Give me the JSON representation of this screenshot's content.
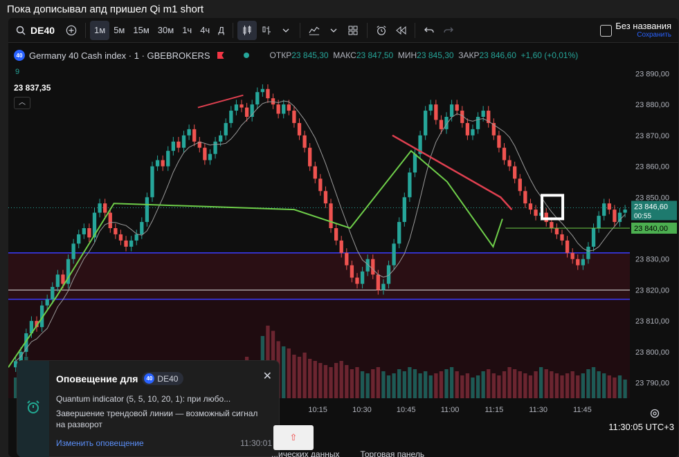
{
  "caption": "Пока дописывал апд пришел Qi m1 short",
  "toolbar": {
    "symbol": "DE40",
    "intervals": [
      {
        "label": "1м",
        "active": true
      },
      {
        "label": "5м",
        "active": false
      },
      {
        "label": "15м",
        "active": false
      },
      {
        "label": "30м",
        "active": false
      },
      {
        "label": "1ч",
        "active": false
      },
      {
        "label": "4ч",
        "active": false
      },
      {
        "label": "Д",
        "active": false
      }
    ],
    "save_title": "Без названия",
    "save_sub": "Сохранить"
  },
  "legend": {
    "badge": "40",
    "title": "Germany 40 Cash index · 1 · GBEBROKERS",
    "open_label": "ОТКР",
    "open": "23 845,30",
    "high_label": "МАКС",
    "high": "23 847,50",
    "low_label": "МИН",
    "low": "23 845,30",
    "close_label": "ЗАКР",
    "close": "23 846,60",
    "change": "+1,60 (+0,01%)",
    "sub": "9",
    "last_value": "23 837,35"
  },
  "chart_data": {
    "type": "candlestick",
    "y_ticks": [
      "23 890,00",
      "23 880,00",
      "23 870,00",
      "23 860,00",
      "23 850,00",
      "23 840,00",
      "23 830,00",
      "23 820,00",
      "23 810,00",
      "23 800,00",
      "23 790,00"
    ],
    "ylim": [
      23785,
      23895
    ],
    "x_ticks": [
      "10:15",
      "10:30",
      "10:45",
      "11:00",
      "11:15",
      "11:30",
      "11:45"
    ],
    "price_label": "23 846,60",
    "price_timer": "00:55",
    "level_label": "23 840,00",
    "level_value": 23840,
    "current_value": 23846.6,
    "zone_top": 23832,
    "zone_bottom": 23817,
    "white_line": 23820,
    "close_path": [
      23797,
      23800,
      23806,
      23810,
      23808,
      23815,
      23817,
      23821,
      23825,
      23822,
      23830,
      23835,
      23838,
      23840,
      23837,
      23845,
      23848,
      23845,
      23840,
      23838,
      23836,
      23834,
      23836,
      23838,
      23842,
      23850,
      23860,
      23862,
      23860,
      23865,
      23868,
      23866,
      23870,
      23872,
      23868,
      23866,
      23862,
      23864,
      23868,
      23870,
      23874,
      23878,
      23880,
      23879,
      23876,
      23880,
      23884,
      23885,
      23882,
      23880,
      23877,
      23880,
      23878,
      23874,
      23870,
      23866,
      23860,
      23856,
      23852,
      23848,
      23840,
      23836,
      23832,
      23828,
      23824,
      23822,
      23826,
      23830,
      23825,
      23820,
      23822,
      23828,
      23835,
      23842,
      23850,
      23858,
      23864,
      23870,
      23878,
      23880,
      23875,
      23872,
      23876,
      23880,
      23878,
      23874,
      23870,
      23872,
      23876,
      23878,
      23874,
      23870,
      23866,
      23862,
      23860,
      23856,
      23852,
      23848,
      23846,
      23844,
      23845,
      23842,
      23840,
      23838,
      23836,
      23832,
      23830,
      23828,
      23830,
      23834,
      23840,
      23844,
      23848,
      23846,
      23842,
      23845,
      23846
    ],
    "trend_red": [
      [
        0.305,
        23879
      ],
      [
        0.378,
        23883
      ]
    ],
    "trend_red2": [
      [
        0.618,
        23870
      ],
      [
        0.792,
        23850
      ],
      [
        0.81,
        23846
      ]
    ],
    "trend_green": [
      [
        0.0,
        23795
      ],
      [
        0.078,
        23818
      ],
      [
        0.17,
        23848
      ],
      [
        0.46,
        23846
      ],
      [
        0.55,
        23840
      ],
      [
        0.648,
        23865
      ],
      [
        0.706,
        23855
      ],
      [
        0.78,
        23834
      ],
      [
        0.795,
        23843
      ]
    ],
    "volume": [
      20,
      25,
      40,
      30,
      35,
      28,
      22,
      30,
      26,
      24,
      28,
      22,
      35,
      30,
      26,
      28,
      22,
      25,
      30,
      28,
      26,
      24,
      20,
      22,
      25,
      28,
      30,
      26,
      24,
      22,
      26,
      28,
      30,
      24,
      22,
      26,
      28,
      30,
      26,
      24,
      28,
      30,
      34,
      36,
      40,
      34,
      30,
      60,
      70,
      65,
      55,
      50,
      48,
      42,
      40,
      44,
      38,
      36,
      34,
      32,
      30,
      34,
      36,
      32,
      28,
      30,
      26,
      24,
      28,
      30,
      26,
      22,
      24,
      28,
      26,
      30,
      28,
      24,
      26,
      22,
      24,
      26,
      28,
      30,
      26,
      22,
      24,
      20,
      22,
      26,
      28,
      24,
      22,
      26,
      30,
      28,
      26,
      24,
      22,
      26,
      30,
      28,
      26,
      24,
      22,
      24,
      26,
      22,
      24,
      28,
      30,
      26,
      24,
      22,
      20,
      22,
      18
    ]
  },
  "alert": {
    "title": "Оповещение для",
    "symbol": "DE40",
    "line1": "Quantum indicator (5, 5, 10, 20, 1): при любо...",
    "line2": "Завершение трендовой линии — возможный сигнал на разворот",
    "link": "Изменить оповещение",
    "time": "11:30:01"
  },
  "clock": "11:30:05 UTC+3",
  "bottom_tabs": [
    "...ических данных",
    "Торговая панель"
  ]
}
